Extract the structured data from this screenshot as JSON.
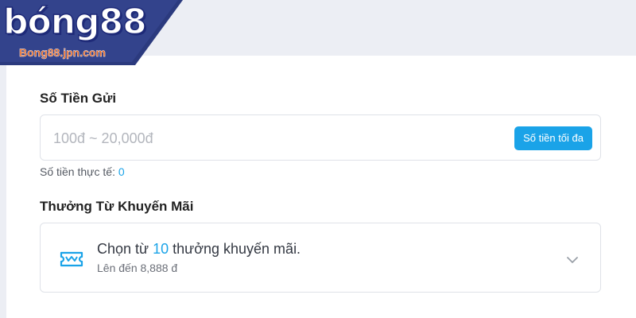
{
  "logo": {
    "brand": "bóng88",
    "domain": "Bong88.jpn.com"
  },
  "deposit": {
    "title": "Số Tiền Gửi",
    "placeholder": "100đ ~ 20,000đ",
    "max_label": "Số tiền tối đa",
    "actual_label": "Số tiền thực tế: ",
    "actual_value": "0"
  },
  "promo": {
    "title": "Thưởng Từ Khuyến Mãi",
    "choose_prefix": "Chọn từ ",
    "count": "10",
    "choose_suffix": " thưởng khuyến mãi.",
    "up_to": "Lên đến 8,888 đ"
  },
  "colors": {
    "accent": "#1aa3e8",
    "logo_band": "#2b3a7e",
    "page_bg": "#eceef4"
  },
  "icons": {
    "promo": "ticket-icon",
    "expand": "chevron-down-icon"
  }
}
